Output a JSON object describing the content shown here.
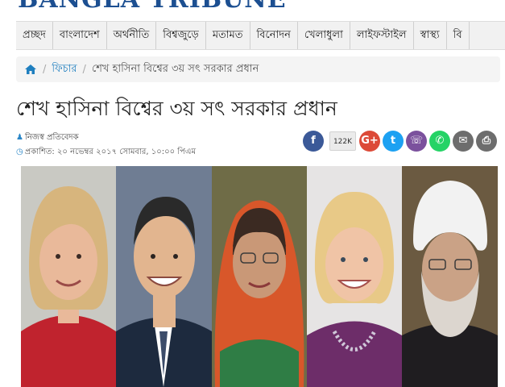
{
  "site": {
    "logo_text": "BANGLA TRIBUNE"
  },
  "nav": {
    "items": [
      "প্রচ্ছদ",
      "বাংলাদেশ",
      "অর্থনীতি",
      "বিশ্বজুড়ে",
      "মতামত",
      "বিনোদন",
      "খেলাধুলা",
      "লাইফস্টাইল",
      "স্বাস্থ্য",
      "বি"
    ]
  },
  "breadcrumb": {
    "home_icon": "home-icon",
    "section": "ফিচার",
    "current": "শেখ হাসিনা বিশ্বের ৩য় সৎ সরকার প্রধান"
  },
  "article": {
    "title": "শেখ হাসিনা বিশ্বের ৩য় সৎ সরকার প্রধান",
    "author": "নিজস্ব প্রতিবেদক",
    "published": "প্রকাশিত: ২০ নভেম্বর ২০১৭ সোমবার, ১০:০০ পিএম"
  },
  "share": {
    "count": "122K",
    "buttons": [
      {
        "name": "facebook-share-button",
        "glyph": "f",
        "color": "#3b5998"
      },
      {
        "name": "google-plus-share-button",
        "glyph": "G+",
        "color": "#dc4a38"
      },
      {
        "name": "twitter-share-button",
        "glyph": "t",
        "color": "#1da1f2"
      },
      {
        "name": "viber-share-button",
        "glyph": "☏",
        "color": "#7b519d"
      },
      {
        "name": "whatsapp-share-button",
        "glyph": "✆",
        "color": "#25d366"
      },
      {
        "name": "email-share-button",
        "glyph": "✉",
        "color": "#6d6d6d"
      },
      {
        "name": "print-share-button",
        "glyph": "⎙",
        "color": "#6d6d6d"
      }
    ]
  },
  "photo": {
    "panels": [
      {
        "bg": "#c9c9c3",
        "skin": "#e9b99a",
        "hair": "#d7b57d",
        "clothes": "#c0232e"
      },
      {
        "bg": "#6f7d93",
        "skin": "#e2b58f",
        "hair": "#2a2a2a",
        "clothes": "#1d2a3e"
      },
      {
        "bg": "#6f6c47",
        "skin": "#c99877",
        "hair": "#3b2a22",
        "clothes": "#d8572a"
      },
      {
        "bg": "#e6e4e4",
        "skin": "#f0c4a6",
        "hair": "#e8c987",
        "clothes": "#6d2d69"
      },
      {
        "bg": "#6b5a41",
        "skin": "#caa286",
        "hair": "#f2f2f2",
        "clothes": "#1f1d20"
      }
    ]
  }
}
